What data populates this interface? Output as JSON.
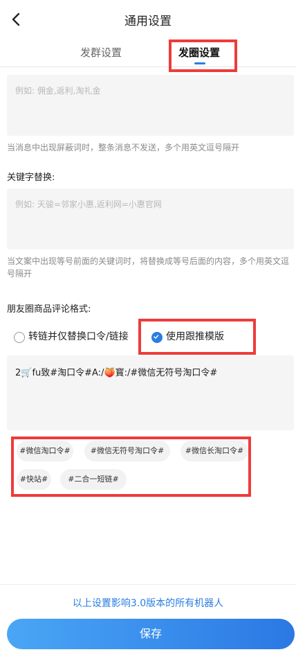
{
  "header": {
    "title": "通用设置",
    "back_icon": "chevron-left-icon"
  },
  "tabs": [
    {
      "label": "发群设置",
      "active": false
    },
    {
      "label": "发圈设置",
      "active": true
    }
  ],
  "shield_words": {
    "placeholder": "例如: 佣金,返利,淘礼金",
    "hint": "当消息中出现屏蔽词时，整条消息不发送，多个用英文逗号隔开"
  },
  "keyword_replace": {
    "label": "关键字替换:",
    "placeholder": "例如: 天骏=邻家小惠,返利网=小惠官网",
    "hint": "当文案中出现等号前面的关键词时，将替换成等号后面的内容，多个用英文逗号隔开"
  },
  "comment_format": {
    "label": "朋友圈商品评论格式:",
    "options": [
      {
        "label": "转链并仅替换口令/链接",
        "checked": false
      },
      {
        "label": "使用跟推模版",
        "checked": true
      }
    ],
    "template_text": "2🛒fu致#淘口令#A:/🍑寳:/#微信无符号淘口令#",
    "tags": [
      "#微信淘口令#",
      "#微信无符号淘口令#",
      "#微信长淘口令#",
      "#快站#",
      "#二合一短链#"
    ]
  },
  "footer": {
    "note": "以上设置影响3.0版本的所有机器人",
    "save_label": "保存"
  },
  "colors": {
    "accent": "#2a7de1",
    "highlight_box": "#ee3b3b"
  }
}
